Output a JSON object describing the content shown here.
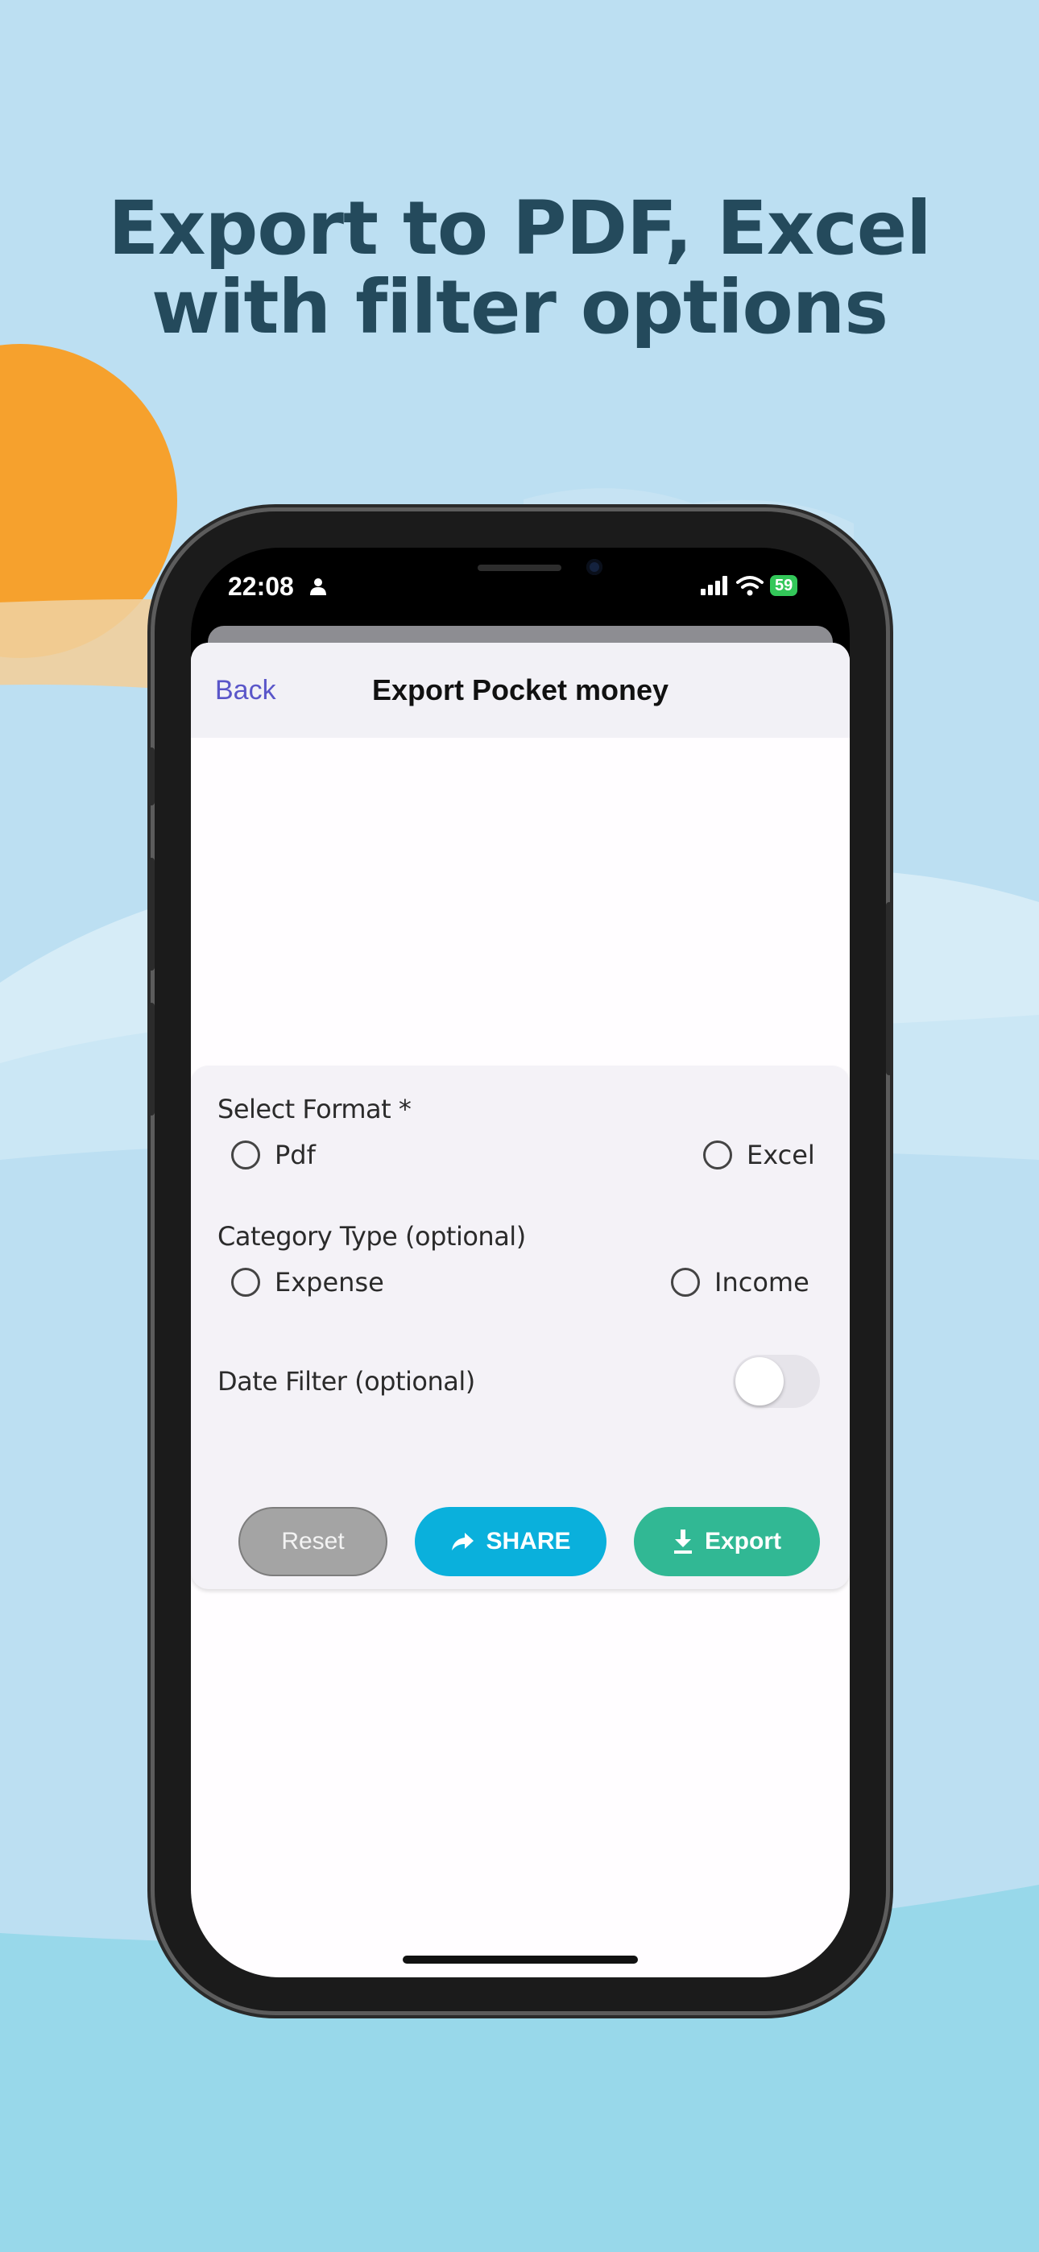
{
  "headline": {
    "line1": "Export to PDF, Excel",
    "line2": "with filter options"
  },
  "status_bar": {
    "time": "22:08",
    "battery": "59"
  },
  "nav": {
    "back_label": "Back",
    "title": "Export Pocket money"
  },
  "form": {
    "format_label": "Select Format *",
    "format_options": [
      "Pdf",
      "Excel"
    ],
    "category_label": "Category Type (optional)",
    "category_options": [
      "Expense",
      "Income"
    ],
    "date_filter_label": "Date Filter (optional)",
    "date_filter_enabled": false
  },
  "buttons": {
    "reset": "Reset",
    "share": "SHARE",
    "export": "Export"
  },
  "colors": {
    "share": "#0ab0dc",
    "export": "#31b894",
    "reset": "#a4a4a4",
    "accent": "#5a56c9",
    "headline": "#244a5c"
  },
  "icons": {
    "share": "share-arrow-icon",
    "export": "download-icon",
    "person": "person-icon"
  }
}
